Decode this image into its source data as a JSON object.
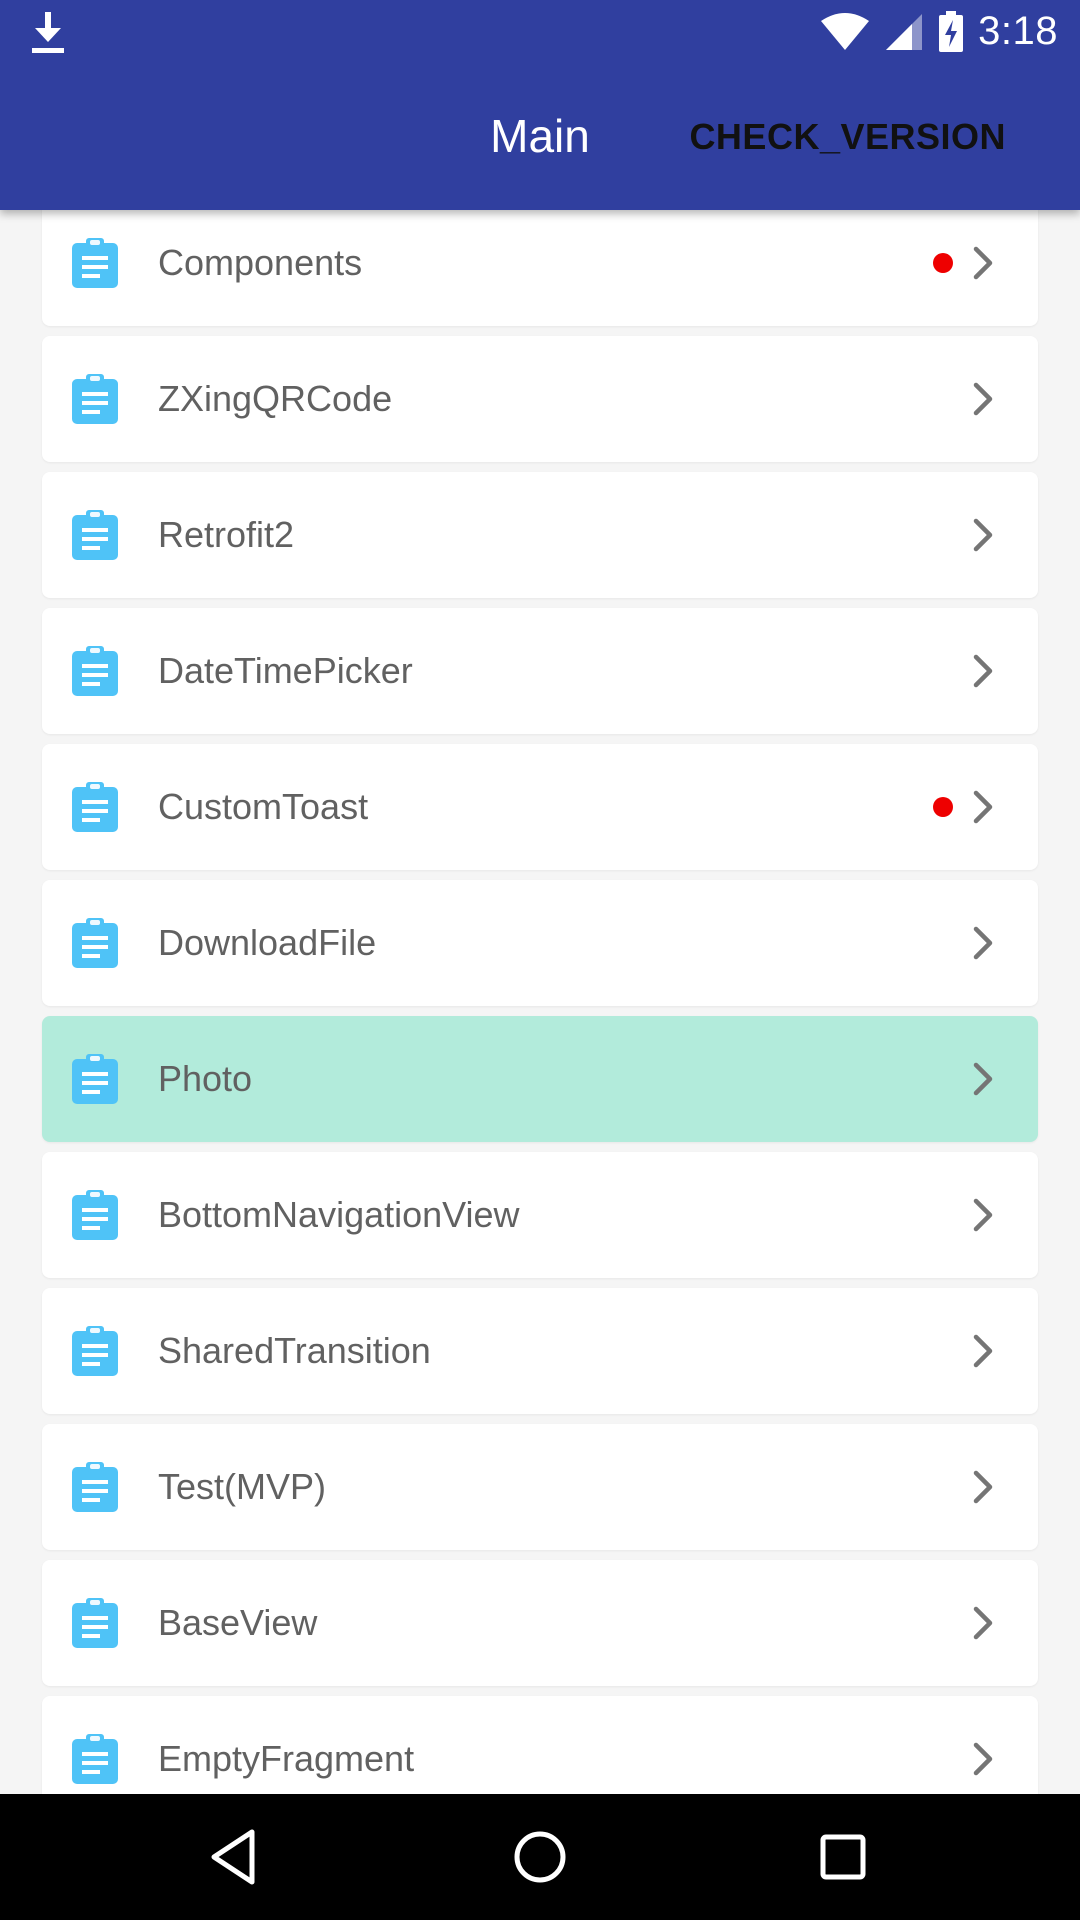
{
  "status_bar": {
    "time": "3:18",
    "icons": [
      "download-icon",
      "wifi-icon",
      "signal-icon",
      "battery-charging-icon"
    ]
  },
  "toolbar": {
    "title": "Main",
    "action_label": "CHECK_VERSION"
  },
  "colors": {
    "primary": "#303f9f",
    "selected_row": "#b2ebdb",
    "icon": "#4fc3f7",
    "badge": "#ee0000",
    "label": "#616161"
  },
  "list": {
    "item_icon": "clipboard-icon",
    "items": [
      {
        "label": "Components",
        "badge": true,
        "selected": false
      },
      {
        "label": "ZXingQRCode",
        "badge": false,
        "selected": false
      },
      {
        "label": "Retrofit2",
        "badge": false,
        "selected": false
      },
      {
        "label": "DateTimePicker",
        "badge": false,
        "selected": false
      },
      {
        "label": "CustomToast",
        "badge": true,
        "selected": false
      },
      {
        "label": "DownloadFile",
        "badge": false,
        "selected": false
      },
      {
        "label": "Photo",
        "badge": false,
        "selected": true
      },
      {
        "label": "BottomNavigationView",
        "badge": false,
        "selected": false
      },
      {
        "label": "SharedTransition",
        "badge": false,
        "selected": false
      },
      {
        "label": "Test(MVP)",
        "badge": false,
        "selected": false
      },
      {
        "label": "BaseView",
        "badge": false,
        "selected": false
      },
      {
        "label": "EmptyFragment",
        "badge": false,
        "selected": false
      }
    ]
  },
  "nav_bar": {
    "buttons": [
      "back-icon",
      "home-icon",
      "recents-icon"
    ]
  }
}
